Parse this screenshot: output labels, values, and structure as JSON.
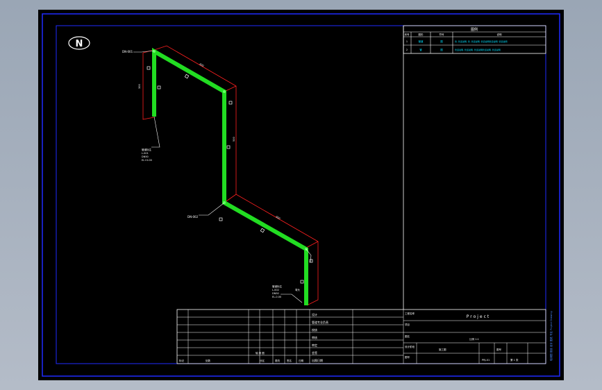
{
  "compass": {
    "label": "N"
  },
  "legend": {
    "title": "图例",
    "headers": [
      "序号",
      "图形",
      "符号",
      "说明"
    ],
    "rows": [
      {
        "no": "1",
        "shape": "管道",
        "symbol": "图",
        "desc": "管, 管道说明, 管, 管道说明, 管道说明管道说明, 管道说明"
      },
      {
        "no": "2",
        "shape": "管",
        "symbol": "图",
        "desc": "管道说明, 管道说明, 管道说明管道说明, 管道说明"
      }
    ]
  },
  "pipe_labels": {
    "top_tag": "DN-001",
    "left_block": [
      "管道标注",
      "L-001",
      "DN50",
      "EL+0.00"
    ],
    "mid_tag": "DN-002",
    "bottom_block": [
      "管道标注",
      "L-002",
      "DN50",
      "EL-0.00"
    ],
    "dim_top": "600",
    "dim_left": "300",
    "dim_right": "500",
    "dim_bottom": "600",
    "elbow_tag": "弯头"
  },
  "title_block": {
    "project": "Project",
    "left_rows": [
      "设计",
      "管道专业负责",
      "校核",
      "审核",
      "审定",
      "会签",
      "出图日期"
    ],
    "left_labels": [
      "标记",
      "处数",
      "分区",
      "更改文件号",
      "签名",
      "日期"
    ],
    "bottom_left": [
      "标记",
      "处数",
      "分区",
      "更改",
      "签名",
      "日期"
    ],
    "mid_code": "轴 测 图",
    "scale": "比例 1:1",
    "drawing_no": "图号",
    "sheet": "第 1 张",
    "stage": "施工图",
    "row_labels": [
      "工程名称",
      "项目",
      "图名",
      "设计阶段",
      "图号"
    ],
    "proj_code": "PRJ-01",
    "right_vertical": "轴测图 管道 设计 图纸 专业 Project Drawing"
  }
}
